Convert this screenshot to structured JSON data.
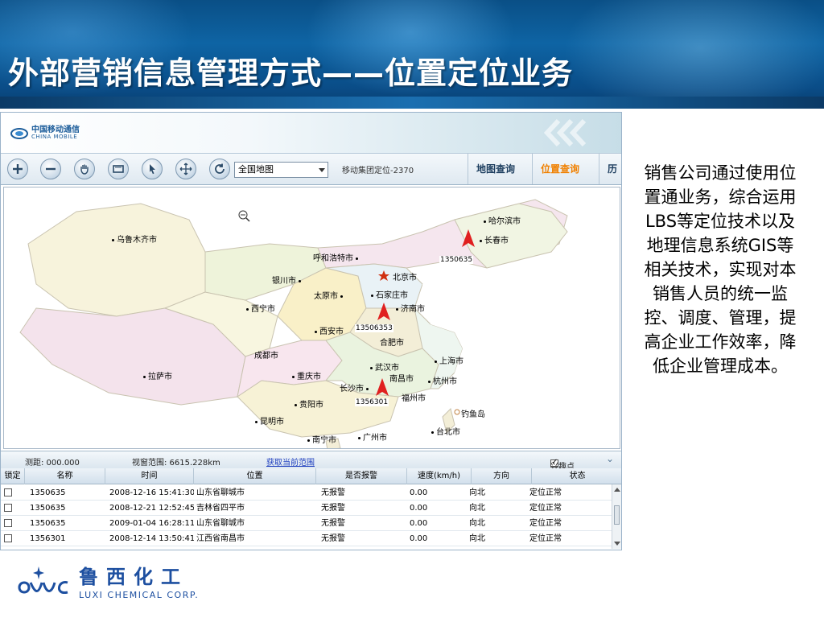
{
  "slide": {
    "title": "外部营销信息管理方式——位置定位业务",
    "description": "销售公司通过使用位置通业务，综合运用LBS等定位技术以及地理信息系统GIS等相关技术，实现对本销售人员的统一监控、调度、管理，提高企业工作效率，降低企业管理成本。"
  },
  "app": {
    "logo_cn": "中国移动通信",
    "logo_en": "CHINA MOBILE",
    "map_select_value": "全国地图",
    "locate_status": "移动集团定位-2370",
    "tabs": [
      {
        "label": "地图查询"
      },
      {
        "label": "位置查询"
      },
      {
        "label": "历"
      }
    ],
    "statusbar": {
      "distance": "测距: 000.000",
      "view_range": "视窗范围: 6615.228km",
      "fetch_link": "获取当前范围",
      "poi_label": "兴趣点"
    }
  },
  "map": {
    "cities": [
      {
        "name": "乌鲁木齐市"
      },
      {
        "name": "哈尔滨市"
      },
      {
        "name": "长春市"
      },
      {
        "name": "呼和浩特市"
      },
      {
        "name": "北京市"
      },
      {
        "name": "银川市"
      },
      {
        "name": "太原市"
      },
      {
        "name": "石家庄市"
      },
      {
        "name": "西宁市"
      },
      {
        "name": "济南市"
      },
      {
        "name": "西安市"
      },
      {
        "name": "合肥市"
      },
      {
        "name": "成都市"
      },
      {
        "name": "上海市"
      },
      {
        "name": "武汉市"
      },
      {
        "name": "拉萨市"
      },
      {
        "name": "重庆市"
      },
      {
        "name": "南昌市"
      },
      {
        "name": "杭州市"
      },
      {
        "name": "长沙市"
      },
      {
        "name": "福州市"
      },
      {
        "name": "贵阳市"
      },
      {
        "name": "钓鱼岛"
      },
      {
        "name": "昆明市"
      },
      {
        "name": "台北市"
      },
      {
        "name": "南宁市"
      },
      {
        "name": "广州市"
      }
    ],
    "vehicles": [
      {
        "label": "1350635"
      },
      {
        "label": "13506353"
      },
      {
        "label": "1356301"
      }
    ]
  },
  "grid": {
    "columns": [
      "锁定",
      "名称",
      "时间",
      "位置",
      "是否报警",
      "速度(km/h)",
      "方向",
      "状态"
    ],
    "rows": [
      {
        "name": "1350635",
        "time": "2008-12-16 15:41:30",
        "location": "山东省聊城市",
        "alarm": "无报警",
        "speed": "0.00",
        "direction": "向北",
        "status": "定位正常"
      },
      {
        "name": "1350635",
        "time": "2008-12-21 12:52:45",
        "location": "吉林省四平市",
        "alarm": "无报警",
        "speed": "0.00",
        "direction": "向北",
        "status": "定位正常"
      },
      {
        "name": "1350635",
        "time": "2009-01-04 16:28:11",
        "location": "山东省聊城市",
        "alarm": "无报警",
        "speed": "0.00",
        "direction": "向北",
        "status": "定位正常"
      },
      {
        "name": "1356301",
        "time": "2008-12-14 13:50:41",
        "location": "江西省南昌市",
        "alarm": "无报警",
        "speed": "0.00",
        "direction": "向北",
        "status": "定位正常"
      }
    ]
  },
  "footer": {
    "company_cn": "鲁西化工",
    "company_en": "LUXI CHEMICAL CORP."
  },
  "colors": {
    "banner": "#0e64a4",
    "active_tab": "#f08000",
    "vehicle_marker": "#e02020",
    "brand_blue": "#1d4fa0"
  }
}
